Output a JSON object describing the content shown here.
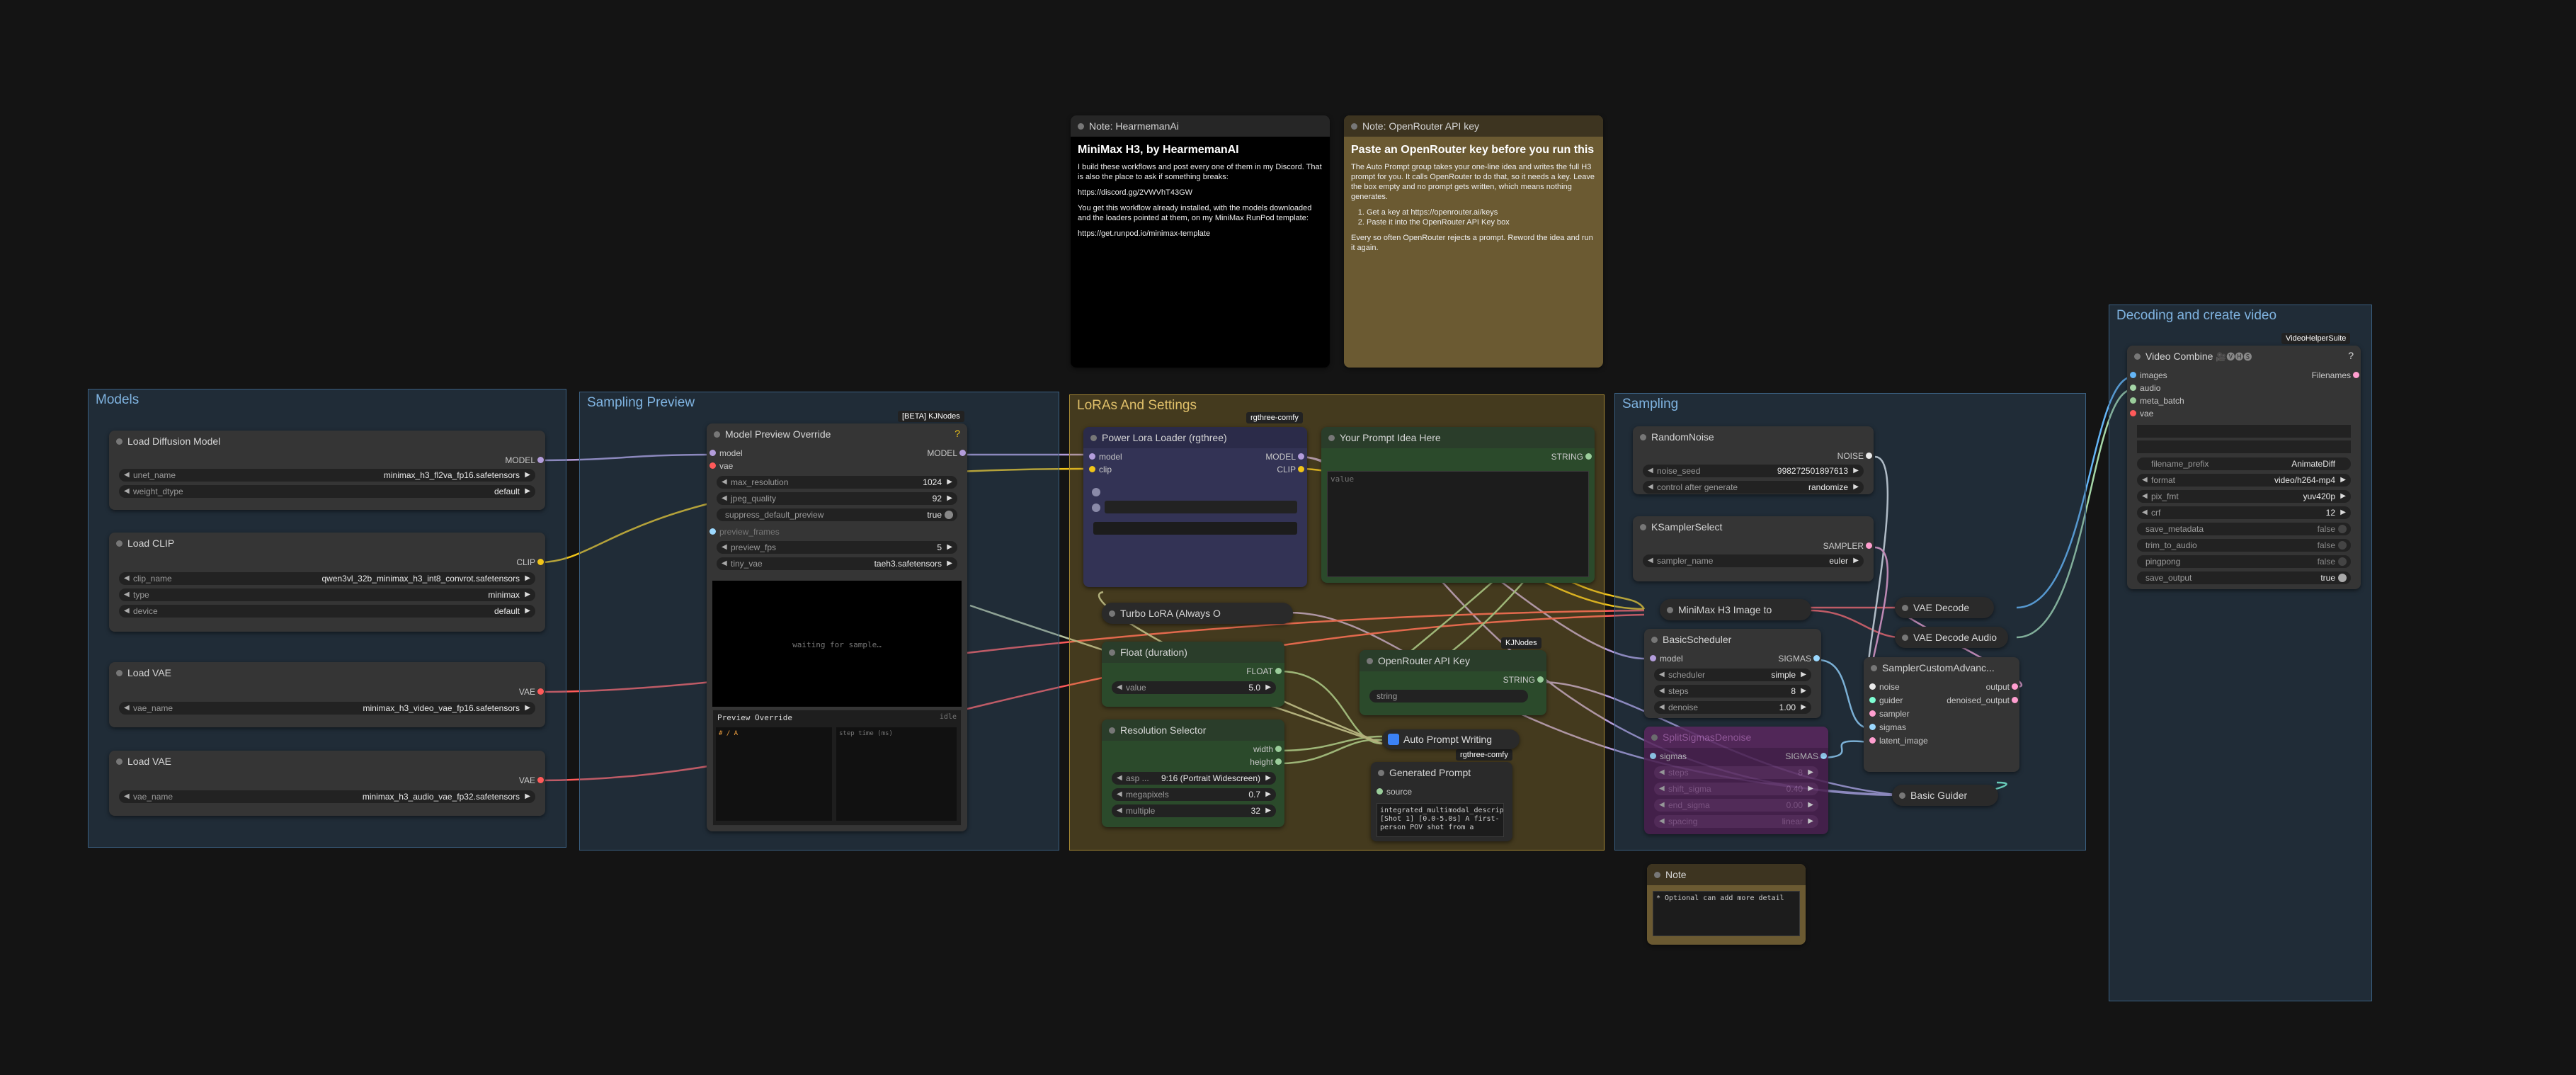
{
  "groups": {
    "models": "Models",
    "sampling_preview": "Sampling Preview",
    "loras": "LoRAs And Settings",
    "sampling": "Sampling",
    "decoding": "Decoding and create video"
  },
  "badges": {
    "kjnodes_beta": "[BETA] KJNodes",
    "rgthree1": "rgthree-comfy",
    "kjnodes": "KJNodes",
    "rgthree2": "rgthree-comfy",
    "vhs": "VideoHelperSuite"
  },
  "note_hearmeman": {
    "title": "Note: HearmemanAi",
    "heading": "MiniMax H3, by HearmemanAI",
    "p1": "I build these workflows and post every one of them in my Discord. That is also the place to ask if something breaks:",
    "p2": "https://discord.gg/2VWVhT43GW",
    "p3": "You get this workflow already installed, with the models downloaded and the loaders pointed at them, on my MiniMax RunPod template:",
    "p4": "https://get.runpod.io/minimax-template"
  },
  "note_openrouter": {
    "title": "Note: OpenRouter API key",
    "heading": "Paste an OpenRouter key before you run this",
    "p1": "The Auto Prompt group takes your one-line idea and writes the full H3 prompt for you. It calls OpenRouter to do that, so it needs a key. Leave the box empty and no prompt gets written, which means nothing generates.",
    "step1": "Get a key at https://openrouter.ai/keys",
    "step2": "Paste it into the OpenRouter API Key box",
    "p2": "Every so often OpenRouter rejects a prompt. Reword the idea and run it again."
  },
  "load_diffusion": {
    "title": "Load Diffusion Model",
    "out": "MODEL",
    "w1_label": "unet_name",
    "w1_value": "minimax_h3_fl2va_fp16.safetensors",
    "w2_label": "weight_dtype",
    "w2_value": "default"
  },
  "load_clip": {
    "title": "Load CLIP",
    "out": "CLIP",
    "w1_label": "clip_name",
    "w1_value": "qwen3vl_32b_minimax_h3_int8_convrot.safetensors",
    "w2_label": "type",
    "w2_value": "minimax",
    "w3_label": "device",
    "w3_value": "default"
  },
  "load_vae1": {
    "title": "Load VAE",
    "out": "VAE",
    "w1_label": "vae_name",
    "w1_value": "minimax_h3_video_vae_fp16.safetensors"
  },
  "load_vae2": {
    "title": "Load VAE",
    "out": "VAE",
    "w1_label": "vae_name",
    "w1_value": "minimax_h3_audio_vae_fp32.safetensors"
  },
  "model_preview": {
    "title": "Model Preview Override",
    "in1": "model",
    "in2": "vae",
    "out": "MODEL",
    "q": "?",
    "w1_label": "max_resolution",
    "w1_value": "1024",
    "w2_label": "jpeg_quality",
    "w2_value": "92",
    "w3_label": "suppress_default_preview",
    "w3_value": "true",
    "w4_label": "preview_frames",
    "w5_label": "preview_fps",
    "w5_value": "5",
    "w6_label": "tiny_vae",
    "w6_value": "taeh3.safetensors",
    "waiting": "waiting for sample…",
    "override_label": "Preview Override",
    "override_right": "idle",
    "frame_label": "# / A",
    "step_label": "step time (ms)"
  },
  "power_lora": {
    "title": "Power Lora Loader (rgthree)",
    "in1": "model",
    "in2": "clip",
    "out1": "MODEL",
    "out2": "CLIP"
  },
  "prompt_idea": {
    "title": "Your Prompt Idea Here",
    "out": "STRING",
    "placeholder": "value"
  },
  "turbo_lora": {
    "title": "Turbo LoRA (Always O"
  },
  "float_duration": {
    "title": "Float (duration)",
    "out": "FLOAT",
    "w1_label": "value",
    "w1_value": "5.0"
  },
  "resolution": {
    "title": "Resolution Selector",
    "out1": "width",
    "out2": "height",
    "w1_label": "asp ...",
    "w1_value": "9:16 (Portrait Widescreen)",
    "w2_label": "megapixels",
    "w2_value": "0.7",
    "w3_label": "multiple",
    "w3_value": "32"
  },
  "openrouter_key": {
    "title": "OpenRouter API Key",
    "out": "STRING",
    "w1_value": "string"
  },
  "auto_prompt": {
    "title": "Auto Prompt Writing"
  },
  "generated_prompt": {
    "title": "Generated Prompt",
    "in1": "source",
    "text": "integrated_multimodal_description: [Shot 1] [0.0-5.0s] A first-person POV shot from a"
  },
  "random_noise": {
    "title": "RandomNoise",
    "out": "NOISE",
    "w1_label": "noise_seed",
    "w1_value": "998272501897613",
    "w2_label": "control after generate",
    "w2_value": "randomize"
  },
  "ksampler_select": {
    "title": "KSamplerSelect",
    "out": "SAMPLER",
    "w1_label": "sampler_name",
    "w1_value": "euler"
  },
  "minimax_h3": {
    "title": "MiniMax H3 Image to"
  },
  "basic_scheduler": {
    "title": "BasicScheduler",
    "in1": "model",
    "out": "SIGMAS",
    "w1_label": "scheduler",
    "w1_value": "simple",
    "w2_label": "steps",
    "w2_value": "8",
    "w3_label": "denoise",
    "w3_value": "1.00"
  },
  "split_sigmas": {
    "title": "SplitSigmasDenoise",
    "in1": "sigmas",
    "out": "SIGMAS",
    "w1_label": "steps",
    "w1_value": "8",
    "w2_label": "shift_sigma",
    "w2_value": "0.40",
    "w3_label": "end_sigma",
    "w3_value": "0.00",
    "w4_label": "spacing",
    "w4_value": "linear"
  },
  "vae_decode": {
    "title": "VAE Decode"
  },
  "vae_decode_audio": {
    "title": "VAE Decode Audio"
  },
  "sampler_custom": {
    "title": "SamplerCustomAdvanc...",
    "in1": "noise",
    "in2": "guider",
    "in3": "sampler",
    "in4": "sigmas",
    "in5": "latent_image",
    "out1": "output",
    "out2": "denoised_output"
  },
  "basic_guider": {
    "title": "Basic Guider"
  },
  "note_small": {
    "title": "Note",
    "text": "* Optional can add more detail"
  },
  "video_combine": {
    "title": "Video Combine",
    "title_icons": "🎥🅥🅗🅢",
    "q": "?",
    "in1": "images",
    "in2": "audio",
    "in3": "meta_batch",
    "in4": "vae",
    "out": "Filenames",
    "w1_label": "filename_prefix",
    "w1_value": "AnimateDiff",
    "w2_label": "format",
    "w2_value": "video/h264-mp4",
    "w3_label": "pix_fmt",
    "w3_value": "yuv420p",
    "w4_label": "crf",
    "w4_value": "12",
    "w5_label": "save_metadata",
    "w5_value": "false",
    "w6_label": "trim_to_audio",
    "w6_value": "false",
    "w7_label": "pingpong",
    "w7_value": "false",
    "w8_label": "save_output",
    "w8_value": "true"
  }
}
